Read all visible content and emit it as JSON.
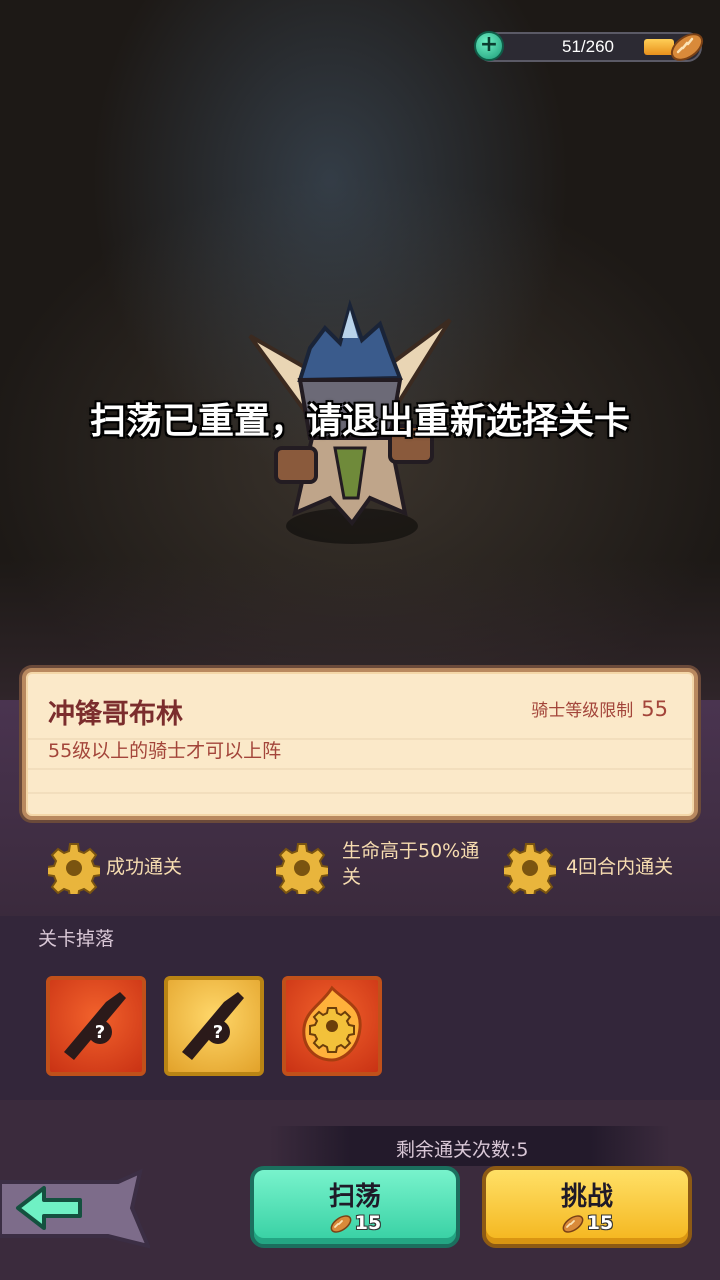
{
  "energy": {
    "current_max": "51/260",
    "level": 0.196,
    "icon": "bread-icon",
    "add_icon": "plus-icon"
  },
  "message": "扫荡已重置，请退出重新选择关卡",
  "stage": {
    "name": "冲锋哥布林",
    "level_label": "骑士等级限制",
    "level_value": "55",
    "description": "55级以上的骑士才可以上阵"
  },
  "goals": [
    {
      "label": "成功通关",
      "icon": "gear-icon"
    },
    {
      "label": "生命高于50%通关",
      "icon": "gear-icon"
    },
    {
      "label": "4回合内通关",
      "icon": "gear-icon"
    }
  ],
  "drops": {
    "title": "关卡掉落",
    "items": [
      {
        "icon": "mystery-weapon-icon",
        "rarity_color": "#e04a1f"
      },
      {
        "icon": "mystery-weapon-icon",
        "rarity_color": "#f0b93a"
      },
      {
        "icon": "fire-gear-icon",
        "rarity_color": "#e04a1f"
      }
    ]
  },
  "remaining": "剩余通关次数:5",
  "buttons": {
    "sweep": {
      "label": "扫荡",
      "cost": "15"
    },
    "challenge": {
      "label": "挑战",
      "cost": "15"
    },
    "back_icon": "back-arrow-icon"
  },
  "colors": {
    "sweep": "#4fe0b4",
    "challenge": "#fcc93a",
    "card": "#fbe9c9",
    "panel": "#3b2b3d"
  }
}
